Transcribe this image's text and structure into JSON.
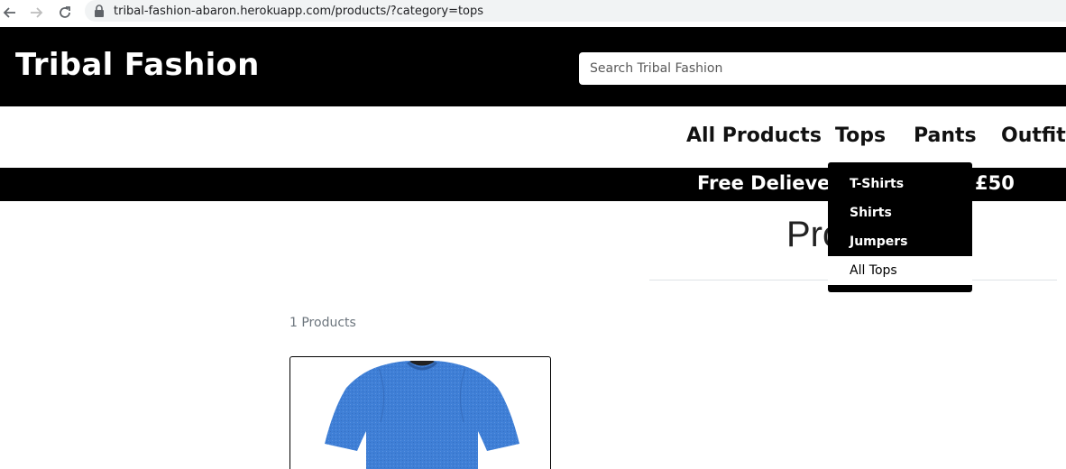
{
  "browser": {
    "url": "tribal-fashion-abaron.herokuapp.com/products/?category=tops"
  },
  "header": {
    "logo": "Tribal Fashion",
    "search_placeholder": "Search Tribal Fashion"
  },
  "nav": {
    "items": [
      {
        "label": "All Products"
      },
      {
        "label": "Tops"
      },
      {
        "label": "Pants"
      },
      {
        "label": "Outfits"
      }
    ]
  },
  "banner": {
    "text_left": "Free Delievery",
    "text_right": "£50"
  },
  "dropdown": {
    "items": [
      {
        "label": "T-Shirts"
      },
      {
        "label": "Shirts"
      },
      {
        "label": "Jumpers"
      },
      {
        "label": "All Tops"
      }
    ]
  },
  "main": {
    "title": "Pro",
    "product_count": "1 Products"
  },
  "colors": {
    "header_bg": "#000000",
    "shirt": "#3f7fd6"
  }
}
